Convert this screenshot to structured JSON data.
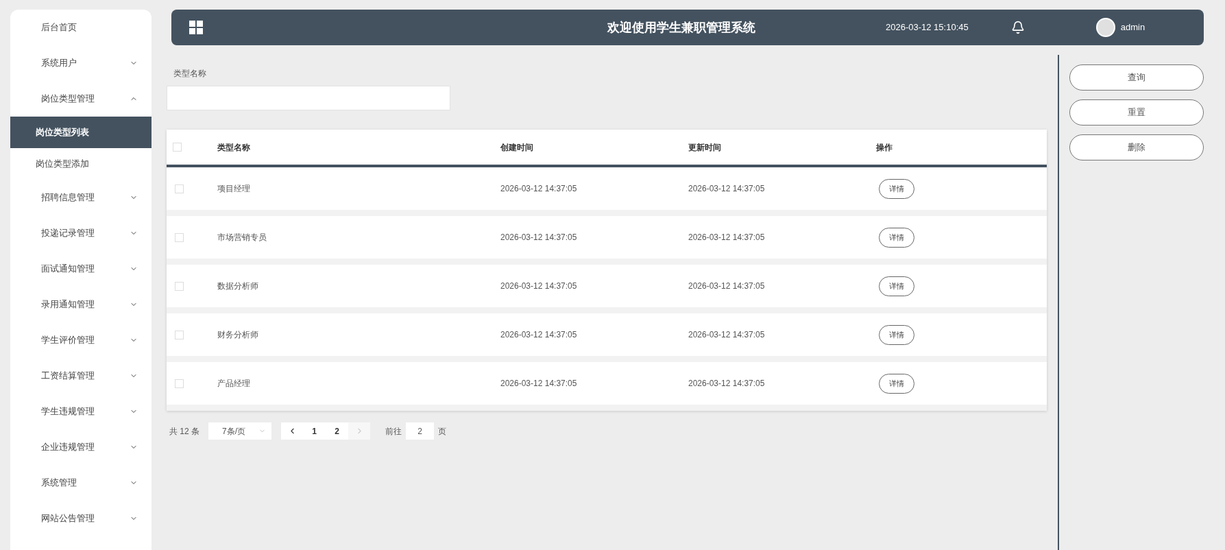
{
  "sidebar": {
    "items": [
      {
        "label": "后台首页",
        "selected": false
      },
      {
        "label": "系统用户",
        "expandable": true,
        "expanded": false,
        "selected": false
      },
      {
        "label": "岗位类型管理",
        "expandable": true,
        "expanded": true,
        "selected": false,
        "children": [
          {
            "label": "岗位类型列表",
            "selected": true
          },
          {
            "label": "岗位类型添加",
            "selected": false
          }
        ]
      },
      {
        "label": "招聘信息管理",
        "expandable": true,
        "expanded": false,
        "selected": false
      },
      {
        "label": "投递记录管理",
        "expandable": true,
        "expanded": false,
        "selected": false
      },
      {
        "label": "面试通知管理",
        "expandable": true,
        "expanded": false,
        "selected": false
      },
      {
        "label": "录用通知管理",
        "expandable": true,
        "expanded": false,
        "selected": false
      },
      {
        "label": "学生评价管理",
        "expandable": true,
        "expanded": false,
        "selected": false
      },
      {
        "label": "工资结算管理",
        "expandable": true,
        "expanded": false,
        "selected": false
      },
      {
        "label": "学生违规管理",
        "expandable": true,
        "expanded": false,
        "selected": false
      },
      {
        "label": "企业违规管理",
        "expandable": true,
        "expanded": false,
        "selected": false
      },
      {
        "label": "系统管理",
        "expandable": true,
        "expanded": false,
        "selected": false
      },
      {
        "label": "网站公告管理",
        "expandable": true,
        "expanded": false,
        "selected": false
      }
    ]
  },
  "header": {
    "title": "欢迎使用学生兼职管理系统",
    "datetime": "2026-03-12 15:10:45",
    "username": "admin"
  },
  "search": {
    "label": "类型名称"
  },
  "table": {
    "columns": [
      "类型名称",
      "创建时间",
      "更新时间",
      "操作"
    ],
    "header_checked": false,
    "rows": [
      {
        "checked": false,
        "name": "项目经理",
        "created": "2026-03-12 14:37:05",
        "updated": "2026-03-12 14:37:05",
        "action": "详情"
      },
      {
        "checked": false,
        "name": "市场营销专员",
        "created": "2026-03-12 14:37:05",
        "updated": "2026-03-12 14:37:05",
        "action": "详情"
      },
      {
        "checked": false,
        "name": "数据分析师",
        "created": "2026-03-12 14:37:05",
        "updated": "2026-03-12 14:37:05",
        "action": "详情"
      },
      {
        "checked": false,
        "name": "财务分析师",
        "created": "2026-03-12 14:37:05",
        "updated": "2026-03-12 14:37:05",
        "action": "详情"
      },
      {
        "checked": false,
        "name": "产品经理",
        "created": "2026-03-12 14:37:05",
        "updated": "2026-03-12 14:37:05",
        "action": "详情"
      }
    ]
  },
  "pagination": {
    "total": "共 12 条",
    "page_size": "7条/页",
    "prev_disabled": false,
    "next_disabled": true,
    "pages": [
      "1",
      "2"
    ],
    "goto_label": "前往",
    "goto_value": "2",
    "goto_suffix": "页"
  },
  "actions": [
    "查询",
    "重置",
    "删除"
  ]
}
